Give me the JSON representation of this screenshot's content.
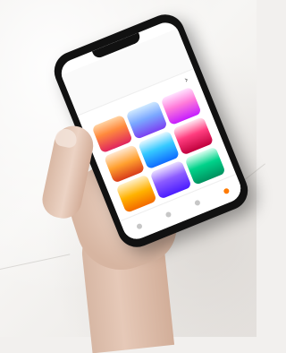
{
  "photo": {
    "brand_color": "#e02020"
  }
}
